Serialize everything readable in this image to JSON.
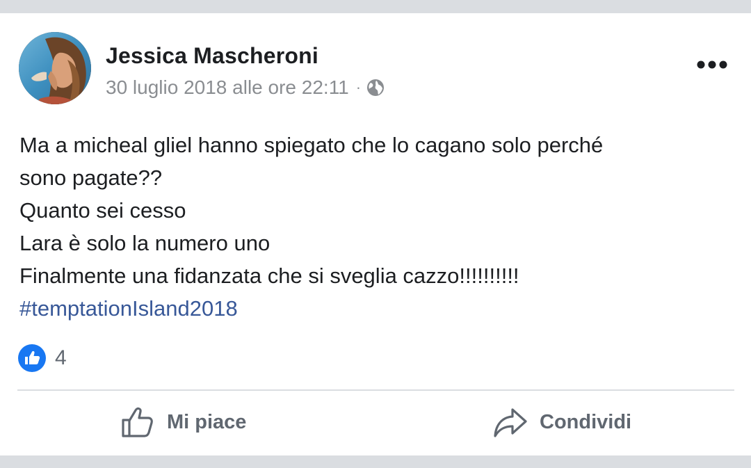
{
  "post": {
    "author": "Jessica Mascheroni",
    "timestamp": "30 luglio 2018 alle ore 22:11",
    "separator": "·",
    "privacy_icon": "globe-icon",
    "more_icon": "more-dots-icon",
    "body_lines": [
      "Ma a micheal gliel hanno spiegato che lo cagano solo perché",
      "sono pagate??",
      "Quanto sei cesso",
      "Lara è solo la numero uno",
      "Finalmente una fidanzata che si sveglia cazzo!!!!!!!!!!"
    ],
    "hashtag": "#temptationIsland2018",
    "reactions": {
      "icon": "like-reaction-icon",
      "count": "4"
    }
  },
  "actions": {
    "like_label": "Mi piace",
    "share_label": "Condividi"
  },
  "colors": {
    "text": "#1c1e21",
    "meta": "#8a8d91",
    "link": "#385898",
    "action": "#606770",
    "like_blue": "#1877f2",
    "band": "#dadde1"
  }
}
